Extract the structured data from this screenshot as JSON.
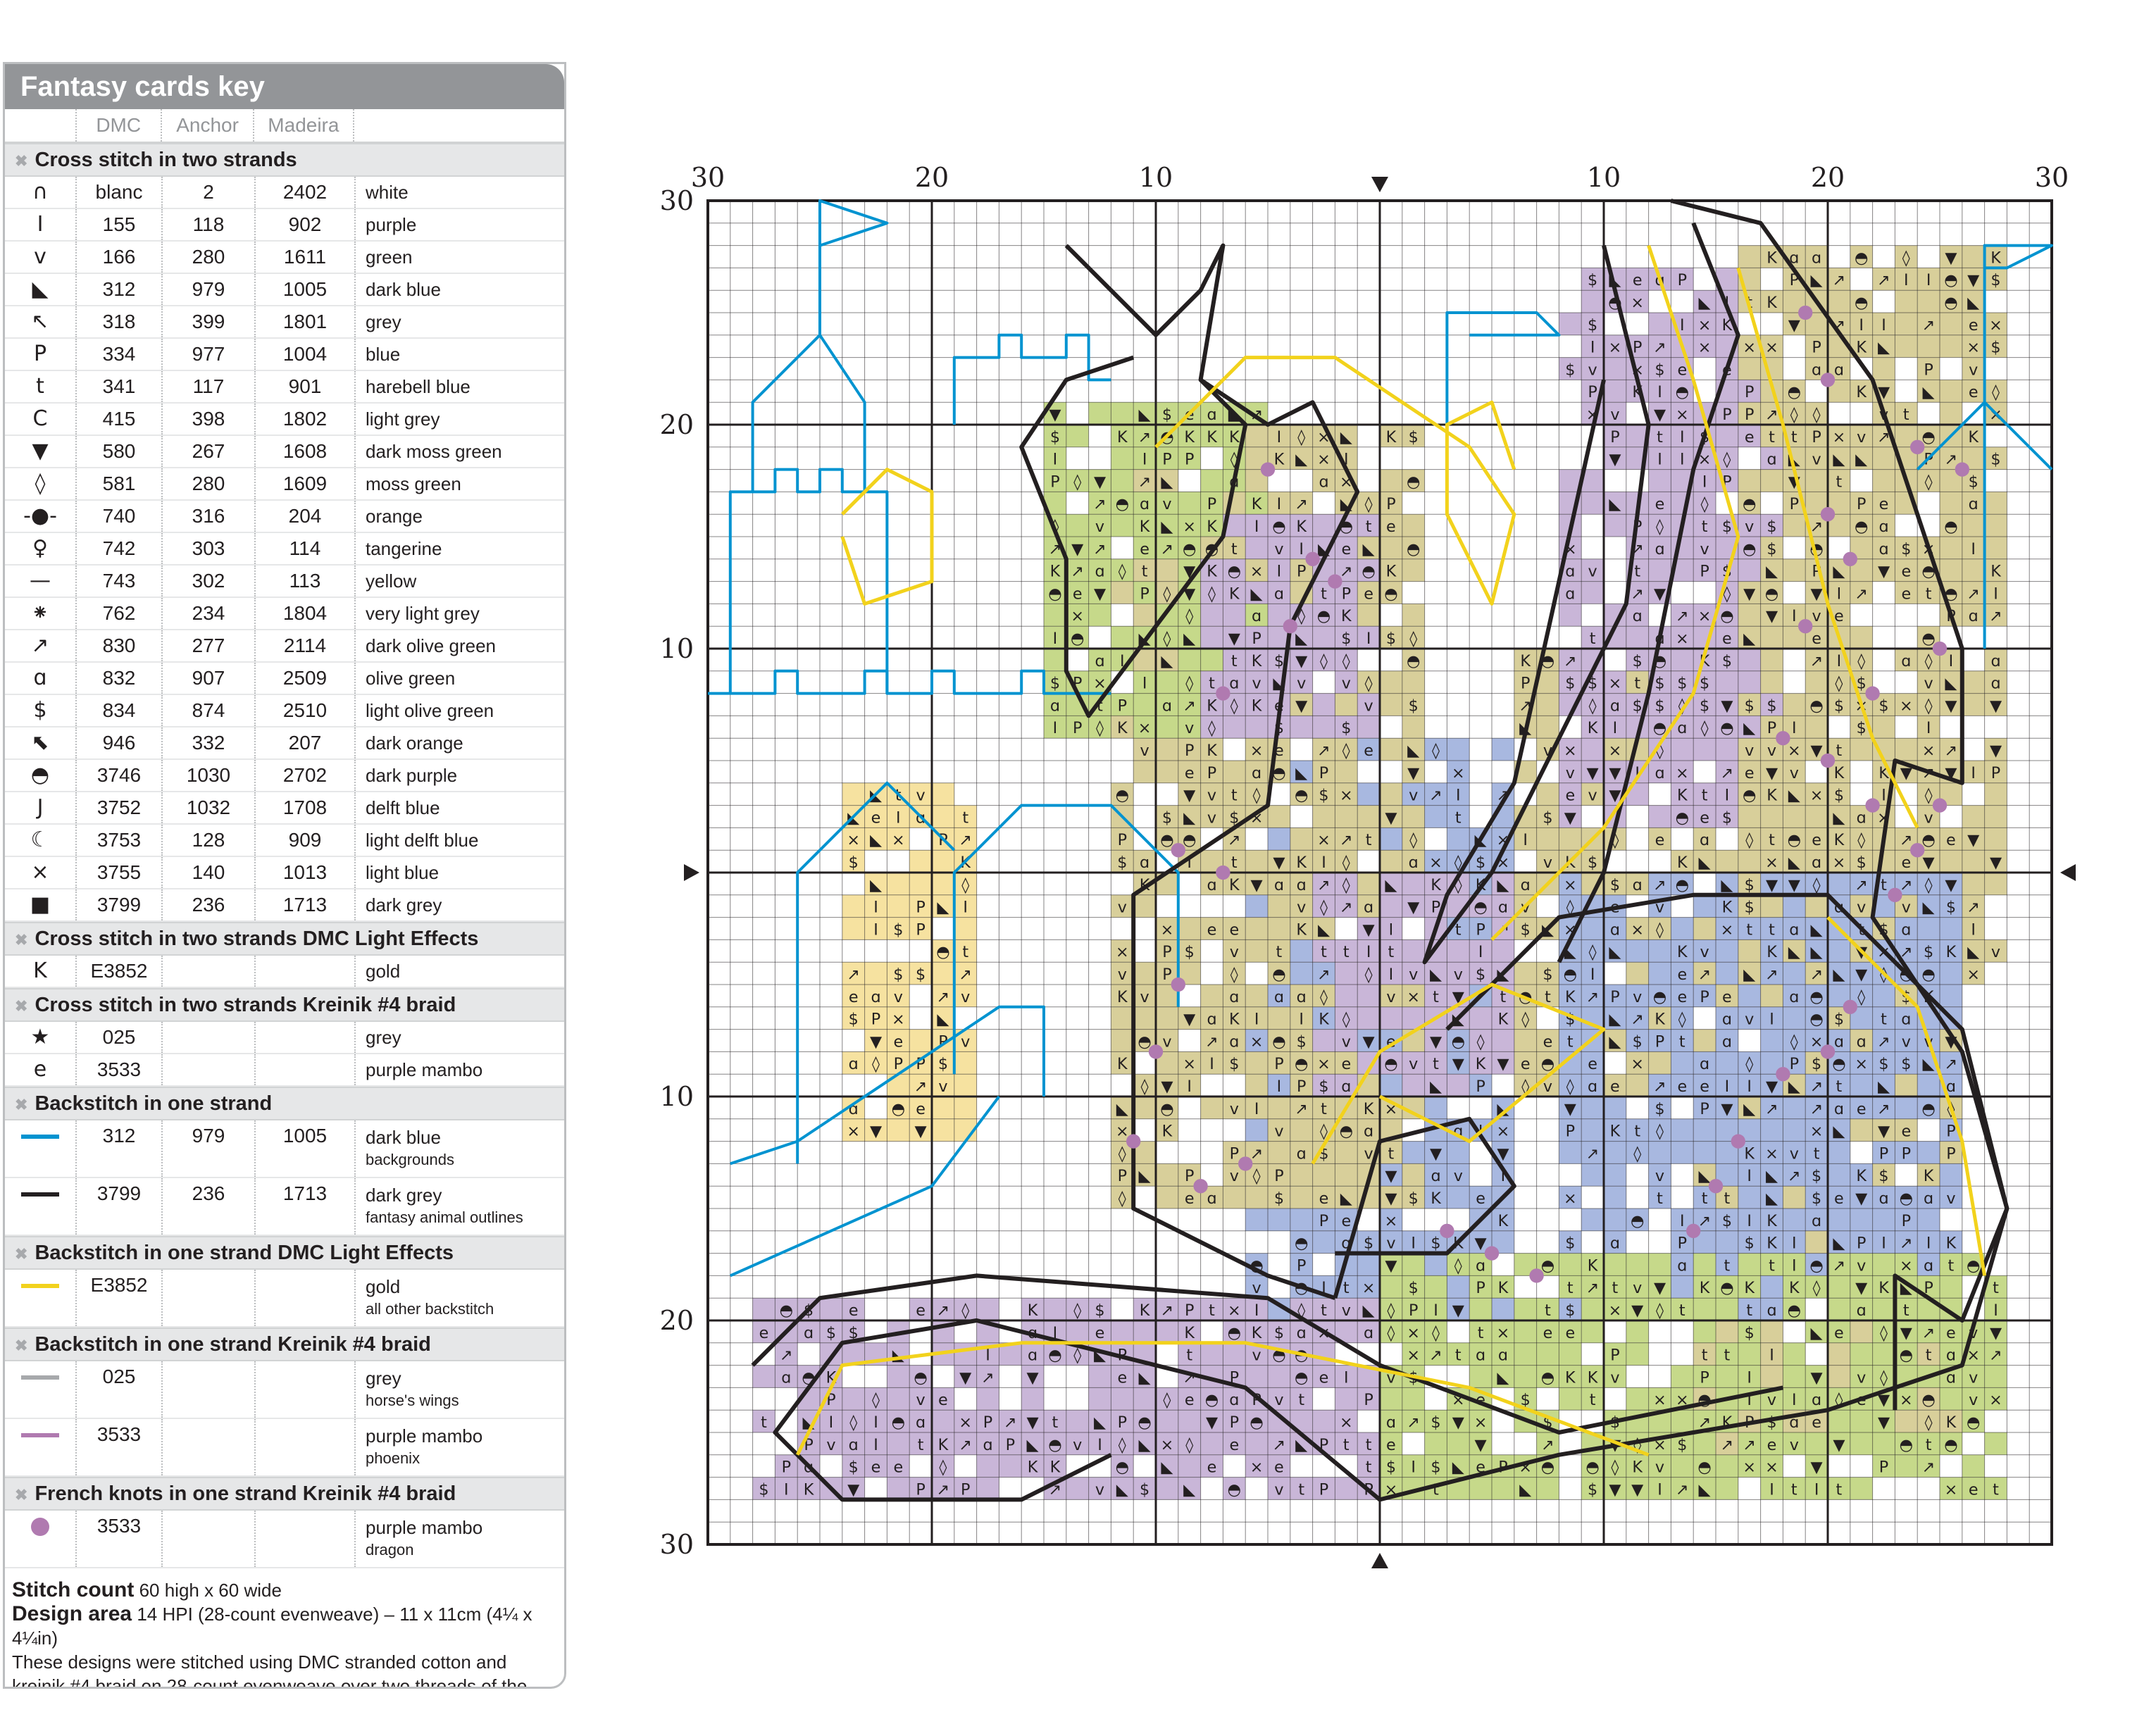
{
  "key": {
    "title": "Fantasy cards key",
    "columns": [
      "DMC",
      "Anchor",
      "Madeira"
    ],
    "sections": [
      {
        "heading": "Cross stitch in two strands",
        "rows": [
          {
            "symbol": "∩",
            "dmc": "blanc",
            "anchor": "2",
            "madeira": "2402",
            "name": "white"
          },
          {
            "symbol": "I",
            "dmc": "155",
            "anchor": "118",
            "madeira": "902",
            "name": "purple"
          },
          {
            "symbol": "v",
            "dmc": "166",
            "anchor": "280",
            "madeira": "1611",
            "name": "green"
          },
          {
            "symbol": "◣",
            "dmc": "312",
            "anchor": "979",
            "madeira": "1005",
            "name": "dark blue"
          },
          {
            "symbol": "↖",
            "dmc": "318",
            "anchor": "399",
            "madeira": "1801",
            "name": "grey"
          },
          {
            "symbol": "P",
            "dmc": "334",
            "anchor": "977",
            "madeira": "1004",
            "name": "blue"
          },
          {
            "symbol": "t",
            "dmc": "341",
            "anchor": "117",
            "madeira": "901",
            "name": "harebell blue"
          },
          {
            "symbol": "C",
            "dmc": "415",
            "anchor": "398",
            "madeira": "1802",
            "name": "light grey"
          },
          {
            "symbol": "▼",
            "dmc": "580",
            "anchor": "267",
            "madeira": "1608",
            "name": "dark moss green"
          },
          {
            "symbol": "◊",
            "dmc": "581",
            "anchor": "280",
            "madeira": "1609",
            "name": "moss green"
          },
          {
            "symbol": "-●-",
            "dmc": "740",
            "anchor": "316",
            "madeira": "204",
            "name": "orange"
          },
          {
            "symbol": "♀",
            "dmc": "742",
            "anchor": "303",
            "madeira": "114",
            "name": "tangerine"
          },
          {
            "symbol": "—",
            "dmc": "743",
            "anchor": "302",
            "madeira": "113",
            "name": "yellow"
          },
          {
            "symbol": "⁕",
            "dmc": "762",
            "anchor": "234",
            "madeira": "1804",
            "name": "very light grey"
          },
          {
            "symbol": "↗",
            "dmc": "830",
            "anchor": "277",
            "madeira": "2114",
            "name": "dark olive green"
          },
          {
            "symbol": "ɑ",
            "dmc": "832",
            "anchor": "907",
            "madeira": "2509",
            "name": "olive green"
          },
          {
            "symbol": "$",
            "dmc": "834",
            "anchor": "874",
            "madeira": "2510",
            "name": "light olive green"
          },
          {
            "symbol": "⬉",
            "dmc": "946",
            "anchor": "332",
            "madeira": "207",
            "name": "dark orange"
          },
          {
            "symbol": "◓",
            "dmc": "3746",
            "anchor": "1030",
            "madeira": "2702",
            "name": "dark purple"
          },
          {
            "symbol": "J",
            "dmc": "3752",
            "anchor": "1032",
            "madeira": "1708",
            "name": "delft blue"
          },
          {
            "symbol": "☾",
            "dmc": "3753",
            "anchor": "128",
            "madeira": "909",
            "name": "light delft blue"
          },
          {
            "symbol": "×",
            "dmc": "3755",
            "anchor": "140",
            "madeira": "1013",
            "name": "light blue"
          },
          {
            "symbol": "■",
            "dmc": "3799",
            "anchor": "236",
            "madeira": "1713",
            "name": "dark grey"
          }
        ]
      },
      {
        "heading": "Cross stitch in two strands DMC Light Effects",
        "rows": [
          {
            "symbol": "K",
            "dmc": "E3852",
            "anchor": "",
            "madeira": "",
            "name": "gold"
          }
        ]
      },
      {
        "heading": "Cross stitch in two strands Kreinik #4 braid",
        "rows": [
          {
            "symbol": "★",
            "dmc": "025",
            "anchor": "",
            "madeira": "",
            "name": "grey"
          },
          {
            "symbol": "e",
            "dmc": "3533",
            "anchor": "",
            "madeira": "",
            "name": "purple mambo"
          }
        ]
      },
      {
        "heading": "Backstitch in one strand",
        "rows": [
          {
            "swatch": "#0093d0",
            "dmc": "312",
            "anchor": "979",
            "madeira": "1005",
            "name": "dark blue",
            "note": "backgrounds"
          },
          {
            "swatch": "#231f20",
            "dmc": "3799",
            "anchor": "236",
            "madeira": "1713",
            "name": "dark grey",
            "note": "fantasy animal outlines"
          }
        ]
      },
      {
        "heading": "Backstitch in one strand DMC Light Effects",
        "rows": [
          {
            "swatch": "#f2d21c",
            "dmc": "E3852",
            "anchor": "",
            "madeira": "",
            "name": "gold",
            "note": "all other backstitch"
          }
        ]
      },
      {
        "heading": "Backstitch in one strand Kreinik #4 braid",
        "rows": [
          {
            "swatch": "#a7a9ac",
            "dmc": "025",
            "anchor": "",
            "madeira": "",
            "name": "grey",
            "note": "horse's wings"
          },
          {
            "swatch": "#b07ab0",
            "dmc": "3533",
            "anchor": "",
            "madeira": "",
            "name": "purple mambo",
            "note": "phoenix"
          }
        ]
      },
      {
        "heading": "French knots in one strand Kreinik #4 braid",
        "rows": [
          {
            "dot": "#b07ab0",
            "dmc": "3533",
            "anchor": "",
            "madeira": "",
            "name": "purple mambo",
            "note": "dragon"
          }
        ]
      }
    ],
    "footer": {
      "stitch_count_label": "Stitch count",
      "stitch_count_value": "60 high x 60 wide",
      "design_area_label": "Design area",
      "design_area_value": "14 HPI (28-count evenweave) – 11 x 11cm (4¼ x 4¼in)",
      "note": "These designs were stitched using DMC stranded cotton and kreinik #4 braid on 28-count evenweave over two threads of the fabric"
    }
  },
  "chart": {
    "top_labels": [
      "30",
      "20",
      "10",
      "10",
      "20",
      "30"
    ],
    "left_labels": [
      "30",
      "20",
      "10",
      "10",
      "20",
      "30"
    ],
    "grid_cells": 60,
    "colors": {
      "grid_line": "#231f20",
      "blue_backstitch": "#0093d0",
      "outline": "#231f20",
      "gold": "#f2d21c",
      "purple_cell": "#c9b6d8",
      "olive_cell": "#d8cf9a",
      "green_cell": "#c6d98a",
      "blue_cell": "#a8b8e0",
      "gold_cell": "#f6e2a0",
      "knot": "#b07ab0"
    }
  }
}
